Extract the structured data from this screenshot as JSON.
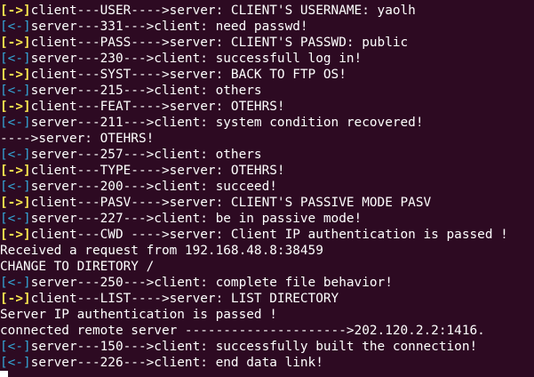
{
  "colors": {
    "background": "#2d0a22",
    "text": "#ffffff",
    "client_to_server_marker": "#fce94f",
    "server_to_client_marker": "#34a8d8"
  },
  "lines": [
    {
      "marker": "[->]",
      "dir": "out",
      "text": "client---USER---->server: CLIENT'S USERNAME: yaolh"
    },
    {
      "marker": "[<-]",
      "dir": "in",
      "text": "server---331--->client: need passwd!"
    },
    {
      "marker": "[->]",
      "dir": "out",
      "text": "client---PASS---->server: CLIENT'S PASSWD: public"
    },
    {
      "marker": "[<-]",
      "dir": "in",
      "text": "server---230--->client: successfull log in!"
    },
    {
      "marker": "[->]",
      "dir": "out",
      "text": "client---SYST---->server: BACK TO FTP OS!"
    },
    {
      "marker": "[<-]",
      "dir": "in",
      "text": "server---215--->client: others"
    },
    {
      "marker": "[->]",
      "dir": "out",
      "text": "client---FEAT---->server: OTEHRS!"
    },
    {
      "marker": "[<-]",
      "dir": "in",
      "text": "server---211--->client: system condition recovered!"
    },
    {
      "marker": "",
      "dir": "none",
      "text": "---->server: OTEHRS!"
    },
    {
      "marker": "[<-]",
      "dir": "in",
      "text": "server---257--->client: others"
    },
    {
      "marker": "[->]",
      "dir": "out",
      "text": "client---TYPE---->server: OTEHRS!"
    },
    {
      "marker": "[<-]",
      "dir": "in",
      "text": "server---200--->client: succeed!"
    },
    {
      "marker": "[->]",
      "dir": "out",
      "text": "client---PASV---->server: CLIENT'S PASSIVE MODE PASV"
    },
    {
      "marker": "[<-]",
      "dir": "in",
      "text": "server---227--->client: be in passive mode!"
    },
    {
      "marker": "[->]",
      "dir": "out",
      "text": "client---CWD ---->server: Client IP authentication is passed !"
    },
    {
      "marker": "",
      "dir": "none",
      "text": "Received a request from 192.168.48.8:38459"
    },
    {
      "marker": "",
      "dir": "none",
      "text": "CHANGE TO DIRETORY /"
    },
    {
      "marker": "[<-]",
      "dir": "in",
      "text": "server---250--->client: complete file behavior!"
    },
    {
      "marker": "[->]",
      "dir": "out",
      "text": "client---LIST---->server: LIST DIRECTORY"
    },
    {
      "marker": "",
      "dir": "none",
      "text": "Server IP authentication is passed !"
    },
    {
      "marker": "",
      "dir": "none",
      "text": "connected remote server --------------------->202.120.2.2:1416."
    },
    {
      "marker": "[<-]",
      "dir": "in",
      "text": "server---150--->client: successfully built the connection!"
    },
    {
      "marker": "[<-]",
      "dir": "in",
      "text": "server---226--->client: end data link!"
    }
  ]
}
